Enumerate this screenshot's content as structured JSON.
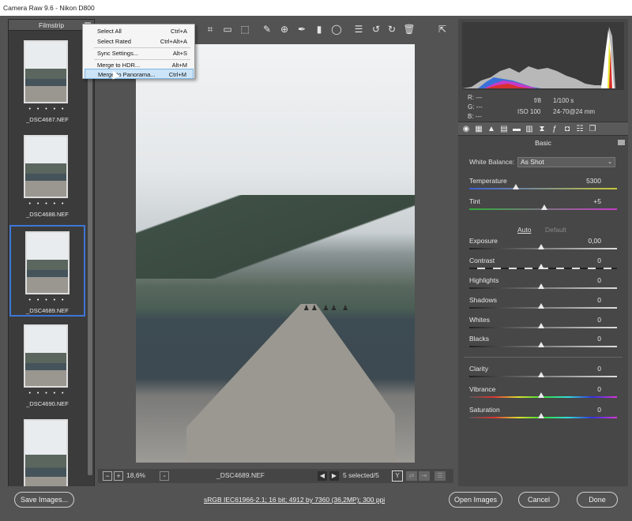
{
  "window": {
    "title": "Camera Raw 9.6  -  Nikon D800"
  },
  "filmstrip": {
    "title": "Filmstrip",
    "items": [
      {
        "name": "_DSC4687.NEF",
        "stars": "• • • • •"
      },
      {
        "name": "_DSC4688.NEF",
        "stars": "• • • • •"
      },
      {
        "name": "_DSC4689.NEF",
        "stars": "• • • • •"
      },
      {
        "name": "_DSC4690.NEF",
        "stars": "• • • • •"
      },
      {
        "name": "",
        "stars": ""
      }
    ]
  },
  "context_menu": {
    "items": [
      {
        "label": "Select All",
        "shortcut": "Ctrl+A"
      },
      {
        "label": "Select Rated",
        "shortcut": "Ctrl+Alt+A"
      },
      {
        "label": "Sync Settings...",
        "shortcut": "Alt+S"
      },
      {
        "label": "Merge to HDR...",
        "shortcut": "Alt+M"
      },
      {
        "label": "Merge to Panorama...",
        "shortcut": "Ctrl+M"
      }
    ]
  },
  "preview_bar": {
    "zoom": "18,6%",
    "filename": "_DSC4689.NEF",
    "selected": "5 selected/5"
  },
  "camera_info": {
    "r": "R:   ---",
    "g": "G:   ---",
    "b": "B:   ---",
    "aperture": "f/8",
    "shutter": "1/100 s",
    "iso": "ISO 100",
    "lens": "24-70@24 mm"
  },
  "panel": {
    "title": "Basic",
    "white_balance_label": "White Balance:",
    "white_balance_value": "As Shot",
    "auto": "Auto",
    "default": "Default",
    "sliders": [
      {
        "label": "Temperature",
        "value": "5300"
      },
      {
        "label": "Tint",
        "value": "+5"
      },
      {
        "label": "Exposure",
        "value": "0,00"
      },
      {
        "label": "Contrast",
        "value": "0"
      },
      {
        "label": "Highlights",
        "value": "0"
      },
      {
        "label": "Shadows",
        "value": "0"
      },
      {
        "label": "Whites",
        "value": "0"
      },
      {
        "label": "Blacks",
        "value": "0"
      },
      {
        "label": "Clarity",
        "value": "0"
      },
      {
        "label": "Vibrance",
        "value": "0"
      },
      {
        "label": "Saturation",
        "value": "0"
      }
    ]
  },
  "footer": {
    "save": "Save Images...",
    "workflow": "sRGB IEC61966-2.1; 16 bit; 4912 by 7360 (36,2MP); 300 ppi",
    "open": "Open Images",
    "cancel": "Cancel",
    "done": "Done"
  },
  "colors": {
    "accent": "#3f76d6",
    "menu_highlight": "#cce4f7"
  }
}
